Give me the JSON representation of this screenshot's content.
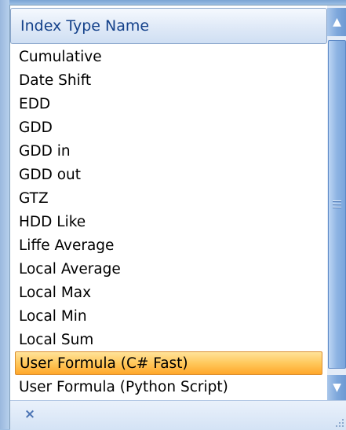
{
  "dropdown": {
    "header": "Index Type Name",
    "items": [
      "Cumulative",
      "Date Shift",
      "EDD",
      "GDD",
      "GDD in",
      "GDD out",
      "GTZ",
      "HDD Like",
      "Liffe Average",
      "Local Average",
      "Local Max",
      "Local Min",
      "Local Sum",
      "User Formula (C# Fast)",
      "User Formula (Python Script)"
    ],
    "selected_index": 13,
    "clear_icon": "×",
    "scroll_up_icon": "▲",
    "scroll_down_icon": "▼"
  },
  "icons": [
    "close-icon",
    "chevron-up-icon",
    "chevron-down-icon",
    "scroll-grip-icon",
    "resize-grip-icon"
  ],
  "colors": {
    "header_text": "#15428b",
    "selection_fill": "#ffc85c",
    "selection_border": "#db8e2f",
    "scrollbar_blue": "#7ea8dc"
  }
}
